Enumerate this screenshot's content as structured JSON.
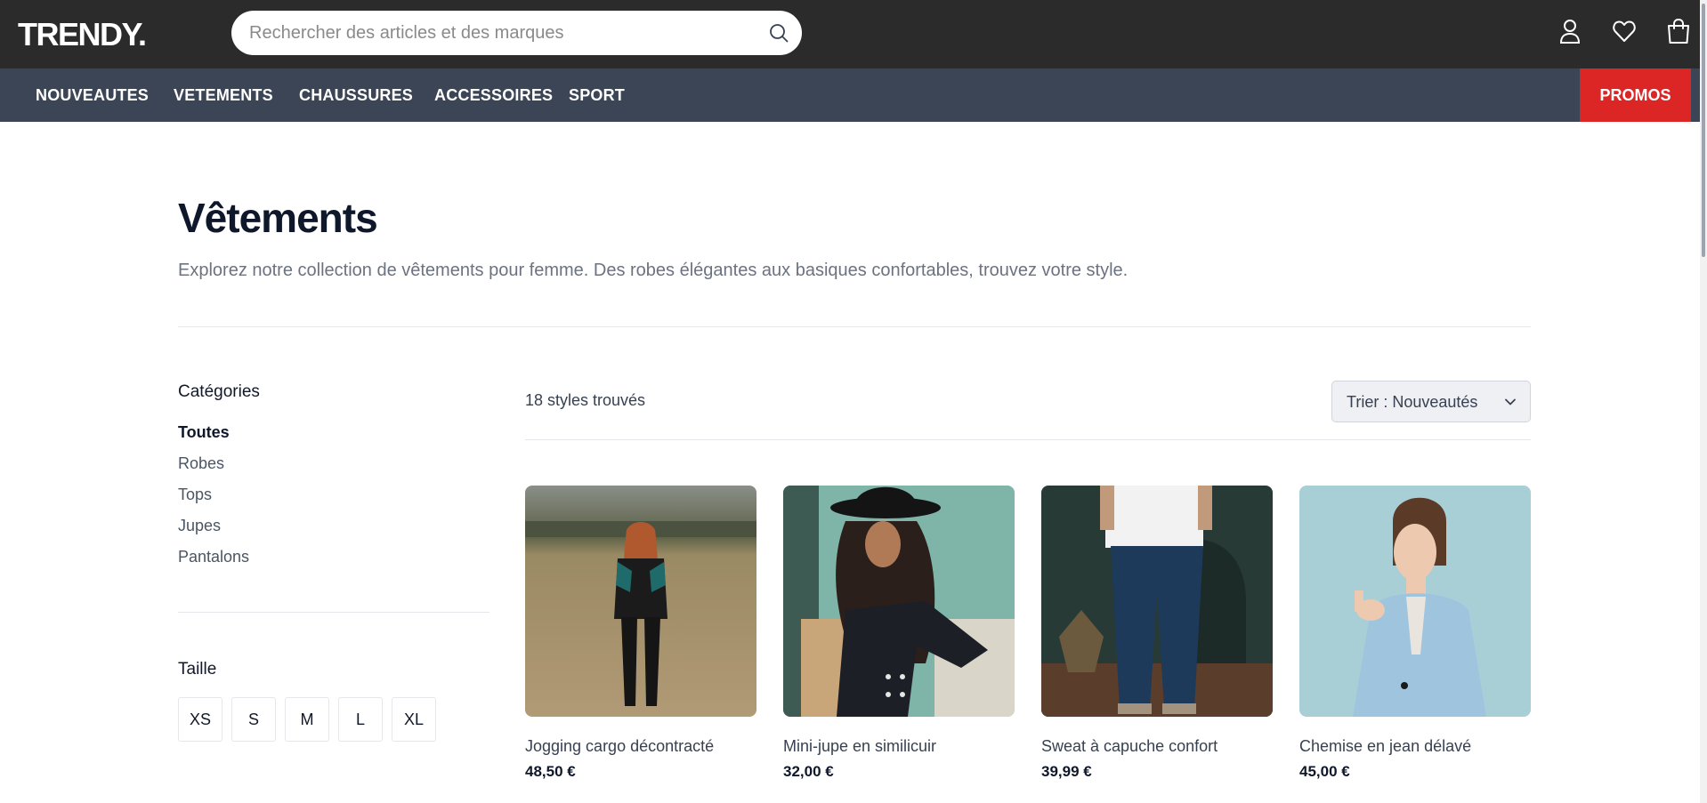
{
  "header": {
    "logo": "TRENDY.",
    "search_placeholder": "Rechercher des articles et des marques",
    "icons": [
      "search-icon",
      "user-icon",
      "heart-icon",
      "shopping-bag-icon"
    ]
  },
  "nav": {
    "items": [
      "NOUVEAUTES",
      "VETEMENTS",
      "CHAUSSURES",
      "ACCESSOIRES",
      "SPORT"
    ],
    "promo": "PROMOS"
  },
  "page": {
    "title": "Vêtements",
    "description": "Explorez notre collection de vêtements pour femme. Des robes élégantes aux basiques confortables, trouvez votre style."
  },
  "sidebar": {
    "categories_heading": "Catégories",
    "categories": [
      "Toutes",
      "Robes",
      "Tops",
      "Jupes",
      "Pantalons"
    ],
    "active_category": "Toutes",
    "size_heading": "Taille",
    "sizes": [
      "XS",
      "S",
      "M",
      "L",
      "XL"
    ]
  },
  "results": {
    "count_label": "18 styles trouvés",
    "sort_label": "Trier : Nouveautés"
  },
  "products": [
    {
      "name": "Jogging cargo décontracté",
      "price": "48,50 €"
    },
    {
      "name": "Mini-jupe en similicuir",
      "price": "32,00 €"
    },
    {
      "name": "Sweat à capuche confort",
      "price": "39,99 €"
    },
    {
      "name": "Chemise en jean délavé",
      "price": "45,00 €"
    }
  ],
  "colors": {
    "topbar": "#2b2b2b",
    "nav": "#3b4556",
    "promo": "#dc2626"
  }
}
